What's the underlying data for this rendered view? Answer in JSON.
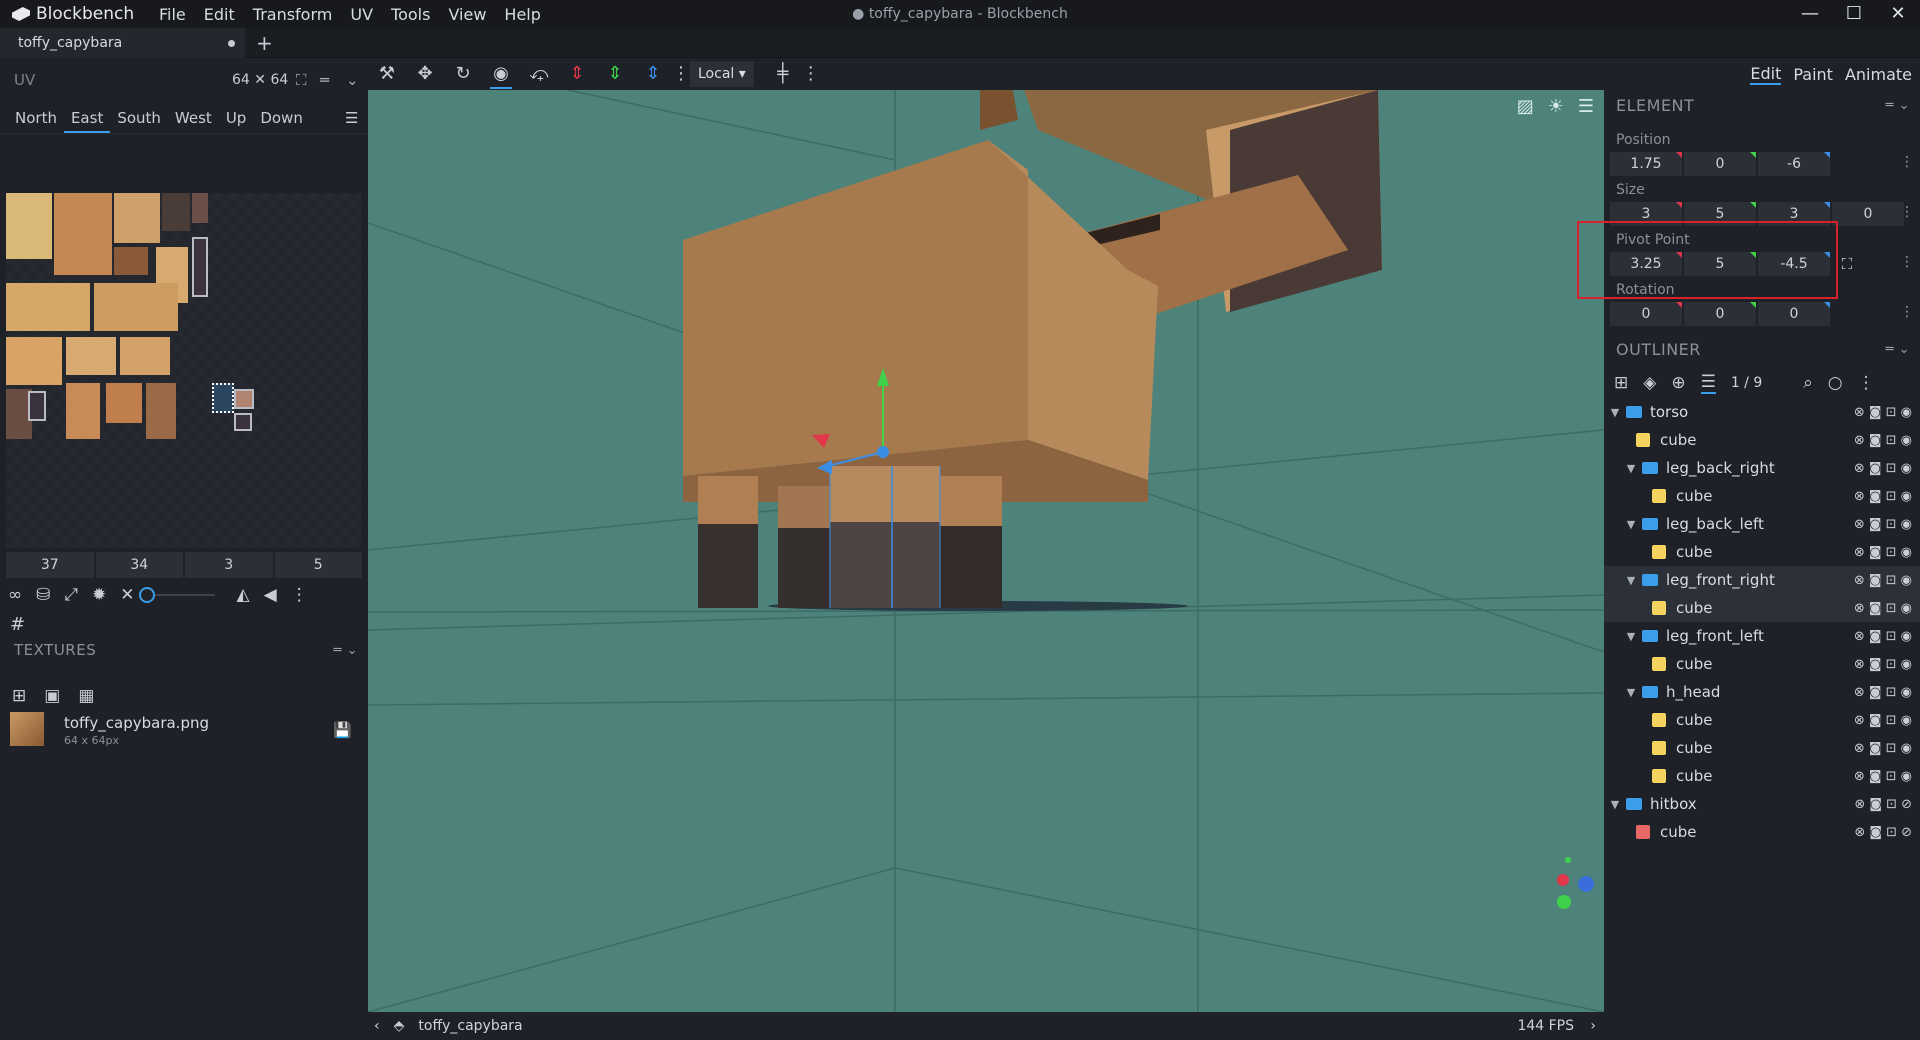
{
  "app": {
    "name": "Blockbench",
    "window_title": "● toffy_capybara - Blockbench",
    "menu": [
      "File",
      "Edit",
      "Transform",
      "UV",
      "Tools",
      "View",
      "Help"
    ],
    "controls": [
      "—",
      "☐",
      "✕"
    ]
  },
  "tabs": [
    {
      "label": "toffy_capybara",
      "unsaved": true
    }
  ],
  "tab_add": "+",
  "uv_panel": {
    "title": "UV",
    "size": "64 ✕ 64",
    "faces": [
      "North",
      "East",
      "South",
      "West",
      "Up",
      "Down"
    ],
    "active_face": "East",
    "fields": [
      "37",
      "34",
      "3",
      "5"
    ]
  },
  "textures": {
    "title": "TEXTURES",
    "items": [
      {
        "name": "toffy_capybara.png",
        "size": "64 x 64px"
      }
    ]
  },
  "toolbar": {
    "space": "Local"
  },
  "modes": [
    "Edit",
    "Paint",
    "Animate"
  ],
  "active_mode": "Edit",
  "element": {
    "title": "ELEMENT",
    "position": {
      "label": "Position",
      "values": [
        "1.75",
        "0",
        "-6"
      ]
    },
    "size": {
      "label": "Size",
      "values": [
        "3",
        "5",
        "3",
        "0"
      ]
    },
    "pivot": {
      "label": "Pivot Point",
      "values": [
        "3.25",
        "5",
        "-4.5"
      ]
    },
    "rotation": {
      "label": "Rotation",
      "values": [
        "0",
        "0",
        "0"
      ]
    }
  },
  "outliner": {
    "title": "OUTLINER",
    "count": "1 / 9",
    "items": [
      {
        "type": "group",
        "name": "torso",
        "level": 0
      },
      {
        "type": "cube",
        "name": "cube",
        "level": 1
      },
      {
        "type": "group",
        "name": "leg_back_right",
        "level": 1
      },
      {
        "type": "cube",
        "name": "cube",
        "level": 2
      },
      {
        "type": "group",
        "name": "leg_back_left",
        "level": 1
      },
      {
        "type": "cube",
        "name": "cube",
        "level": 2
      },
      {
        "type": "group",
        "name": "leg_front_right",
        "level": 1,
        "selected": true
      },
      {
        "type": "cube",
        "name": "cube",
        "level": 2,
        "selected": true
      },
      {
        "type": "group",
        "name": "leg_front_left",
        "level": 1
      },
      {
        "type": "cube",
        "name": "cube",
        "level": 2
      },
      {
        "type": "group",
        "name": "h_head",
        "level": 1
      },
      {
        "type": "cube",
        "name": "cube",
        "level": 2
      },
      {
        "type": "cube",
        "name": "cube",
        "level": 2
      },
      {
        "type": "cube",
        "name": "cube",
        "level": 2
      },
      {
        "type": "group",
        "name": "hitbox",
        "level": 0
      },
      {
        "type": "cube",
        "name": "cube",
        "level": 1,
        "hitbox": true
      }
    ]
  },
  "status": {
    "model": "toffy_capybara",
    "fps": "144 FPS"
  },
  "colors": {
    "accent": "#3a9eeb",
    "viewport": "#4d837b",
    "highlight": "#d8222a"
  }
}
